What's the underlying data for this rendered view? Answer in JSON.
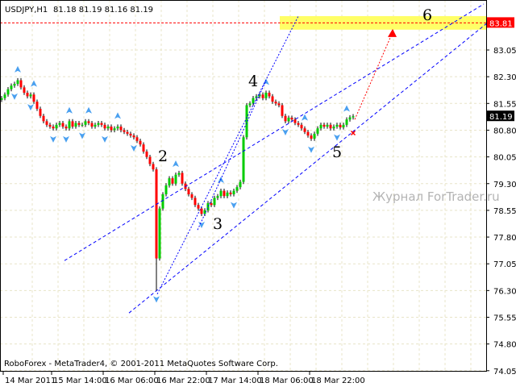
{
  "header": {
    "symbol": "USDJPY,H1",
    "ohlc": "81.18 81.19 81.16 81.19"
  },
  "footer": {
    "copyright": "RoboForex - MetaTrader4, © 2001-2011 MetaQuotes Software Corp."
  },
  "watermark": "Журнал ForTrader.ru",
  "colors": {
    "bull": "#00cc00",
    "bear": "#ff0000",
    "line": "#0000ff",
    "target_band": "#ffff66",
    "target_line": "#ff0000",
    "bid_label": "#000000",
    "grid": "#e8e4c8"
  },
  "chart_data": {
    "type": "candlestick",
    "title": "USDJPY,H1",
    "ylim": [
      74.05,
      84.5
    ],
    "y_ticks": [
      "83.05",
      "82.30",
      "81.55",
      "80.80",
      "80.05",
      "79.30",
      "78.55",
      "77.80",
      "77.05",
      "76.30",
      "75.55",
      "74.80",
      "74.05"
    ],
    "x_ticks": [
      {
        "label": "14 Mar 2011",
        "i": 0
      },
      {
        "label": "15 Mar 14:00",
        "i": 15.5
      },
      {
        "label": "16 Mar 06:00",
        "i": 31.5
      },
      {
        "label": "16 Mar 22:00",
        "i": 47.5
      },
      {
        "label": "17 Mar 14:00",
        "i": 63.5
      },
      {
        "label": "18 Mar 06:00",
        "i": 79.5
      },
      {
        "label": "18 Mar 22:00",
        "i": 95.5
      }
    ],
    "current_price": "81.19",
    "target_price": "83.81",
    "closes": [
      81.7,
      81.8,
      81.95,
      82.05,
      82.1,
      82.2,
      82.0,
      81.85,
      81.75,
      81.8,
      81.6,
      81.4,
      81.2,
      81.05,
      80.95,
      80.9,
      80.85,
      80.95,
      81.0,
      80.9,
      80.85,
      81.05,
      80.9,
      81.0,
      80.95,
      80.95,
      81.05,
      81.0,
      80.9,
      80.95,
      81.0,
      80.95,
      80.85,
      80.9,
      80.8,
      80.85,
      80.9,
      80.8,
      80.75,
      80.7,
      80.65,
      80.6,
      80.5,
      80.4,
      80.2,
      80.05,
      79.85,
      79.7,
      77.2,
      78.6,
      79.0,
      79.25,
      79.45,
      79.3,
      79.55,
      79.6,
      79.3,
      79.15,
      79.0,
      78.9,
      78.7,
      78.6,
      78.45,
      78.55,
      78.75,
      78.7,
      78.9,
      78.95,
      79.1,
      78.95,
      79.05,
      79.0,
      79.1,
      79.2,
      79.35,
      80.6,
      81.5,
      81.55,
      81.7,
      81.75,
      81.8,
      81.7,
      81.85,
      81.75,
      81.6,
      81.55,
      81.5,
      81.2,
      81.05,
      81.15,
      81.1,
      81.0,
      80.95,
      80.85,
      80.75,
      80.65,
      80.56,
      80.7,
      80.85,
      80.95,
      80.9,
      80.95,
      80.85,
      80.9,
      80.95,
      80.88,
      80.95,
      81.1,
      81.16,
      81.19
    ],
    "spike_low": {
      "i": 48,
      "price": 76.3
    },
    "fractals": [
      {
        "i": 5,
        "type": "up"
      },
      {
        "i": 10,
        "type": "up"
      },
      {
        "i": 21,
        "type": "up"
      },
      {
        "i": 27,
        "type": "up"
      },
      {
        "i": 36,
        "type": "up"
      },
      {
        "i": 54,
        "type": "up"
      },
      {
        "i": 68,
        "type": "up"
      },
      {
        "i": 82,
        "type": "up"
      },
      {
        "i": 94,
        "type": "up"
      },
      {
        "i": 107,
        "type": "up"
      },
      {
        "i": 4,
        "type": "down"
      },
      {
        "i": 9,
        "type": "down"
      },
      {
        "i": 16,
        "type": "down"
      },
      {
        "i": 20,
        "type": "down"
      },
      {
        "i": 25,
        "type": "down"
      },
      {
        "i": 32,
        "type": "down"
      },
      {
        "i": 41,
        "type": "down"
      },
      {
        "i": 48,
        "type": "down"
      },
      {
        "i": 62,
        "type": "down"
      },
      {
        "i": 72,
        "type": "down"
      },
      {
        "i": 88,
        "type": "down"
      },
      {
        "i": 96,
        "type": "down"
      },
      {
        "i": 104,
        "type": "down"
      }
    ],
    "lines": [
      {
        "name": "upper-channel",
        "from": [
          19.5,
          77.14
        ],
        "to": [
          149.5,
          84.34
        ],
        "style": "dashed"
      },
      {
        "name": "lower-channel",
        "from": [
          39.5,
          75.67
        ],
        "to": [
          150.75,
          83.82
        ],
        "style": "dashed"
      },
      {
        "name": "wave-line-2-6",
        "from": [
          48.25,
          76.2
        ],
        "to": [
          92,
          84.0
        ],
        "style": "dotted"
      },
      {
        "name": "wave-line-3-4",
        "from": [
          60.75,
          78.0
        ],
        "to": [
          82,
          82.19
        ],
        "style": "dotted"
      }
    ],
    "target_zone": {
      "from_i": 86.25,
      "to_i": 150.25,
      "low": 83.62,
      "high": 84.0
    },
    "forecast_arrow": {
      "from": [
        109.5,
        81.1
      ],
      "to": [
        121.25,
        83.55
      ]
    },
    "cross_marker": {
      "i": 109,
      "price": 80.72
    },
    "wave_labels": [
      {
        "text": "2",
        "i": 50,
        "price": 80.09
      },
      {
        "text": "3",
        "i": 67,
        "price": 78.19
      },
      {
        "text": "4",
        "i": 78,
        "price": 82.19
      },
      {
        "text": "5",
        "i": 104,
        "price": 80.2
      },
      {
        "text": "6",
        "i": 132,
        "price": 84.05
      }
    ]
  }
}
